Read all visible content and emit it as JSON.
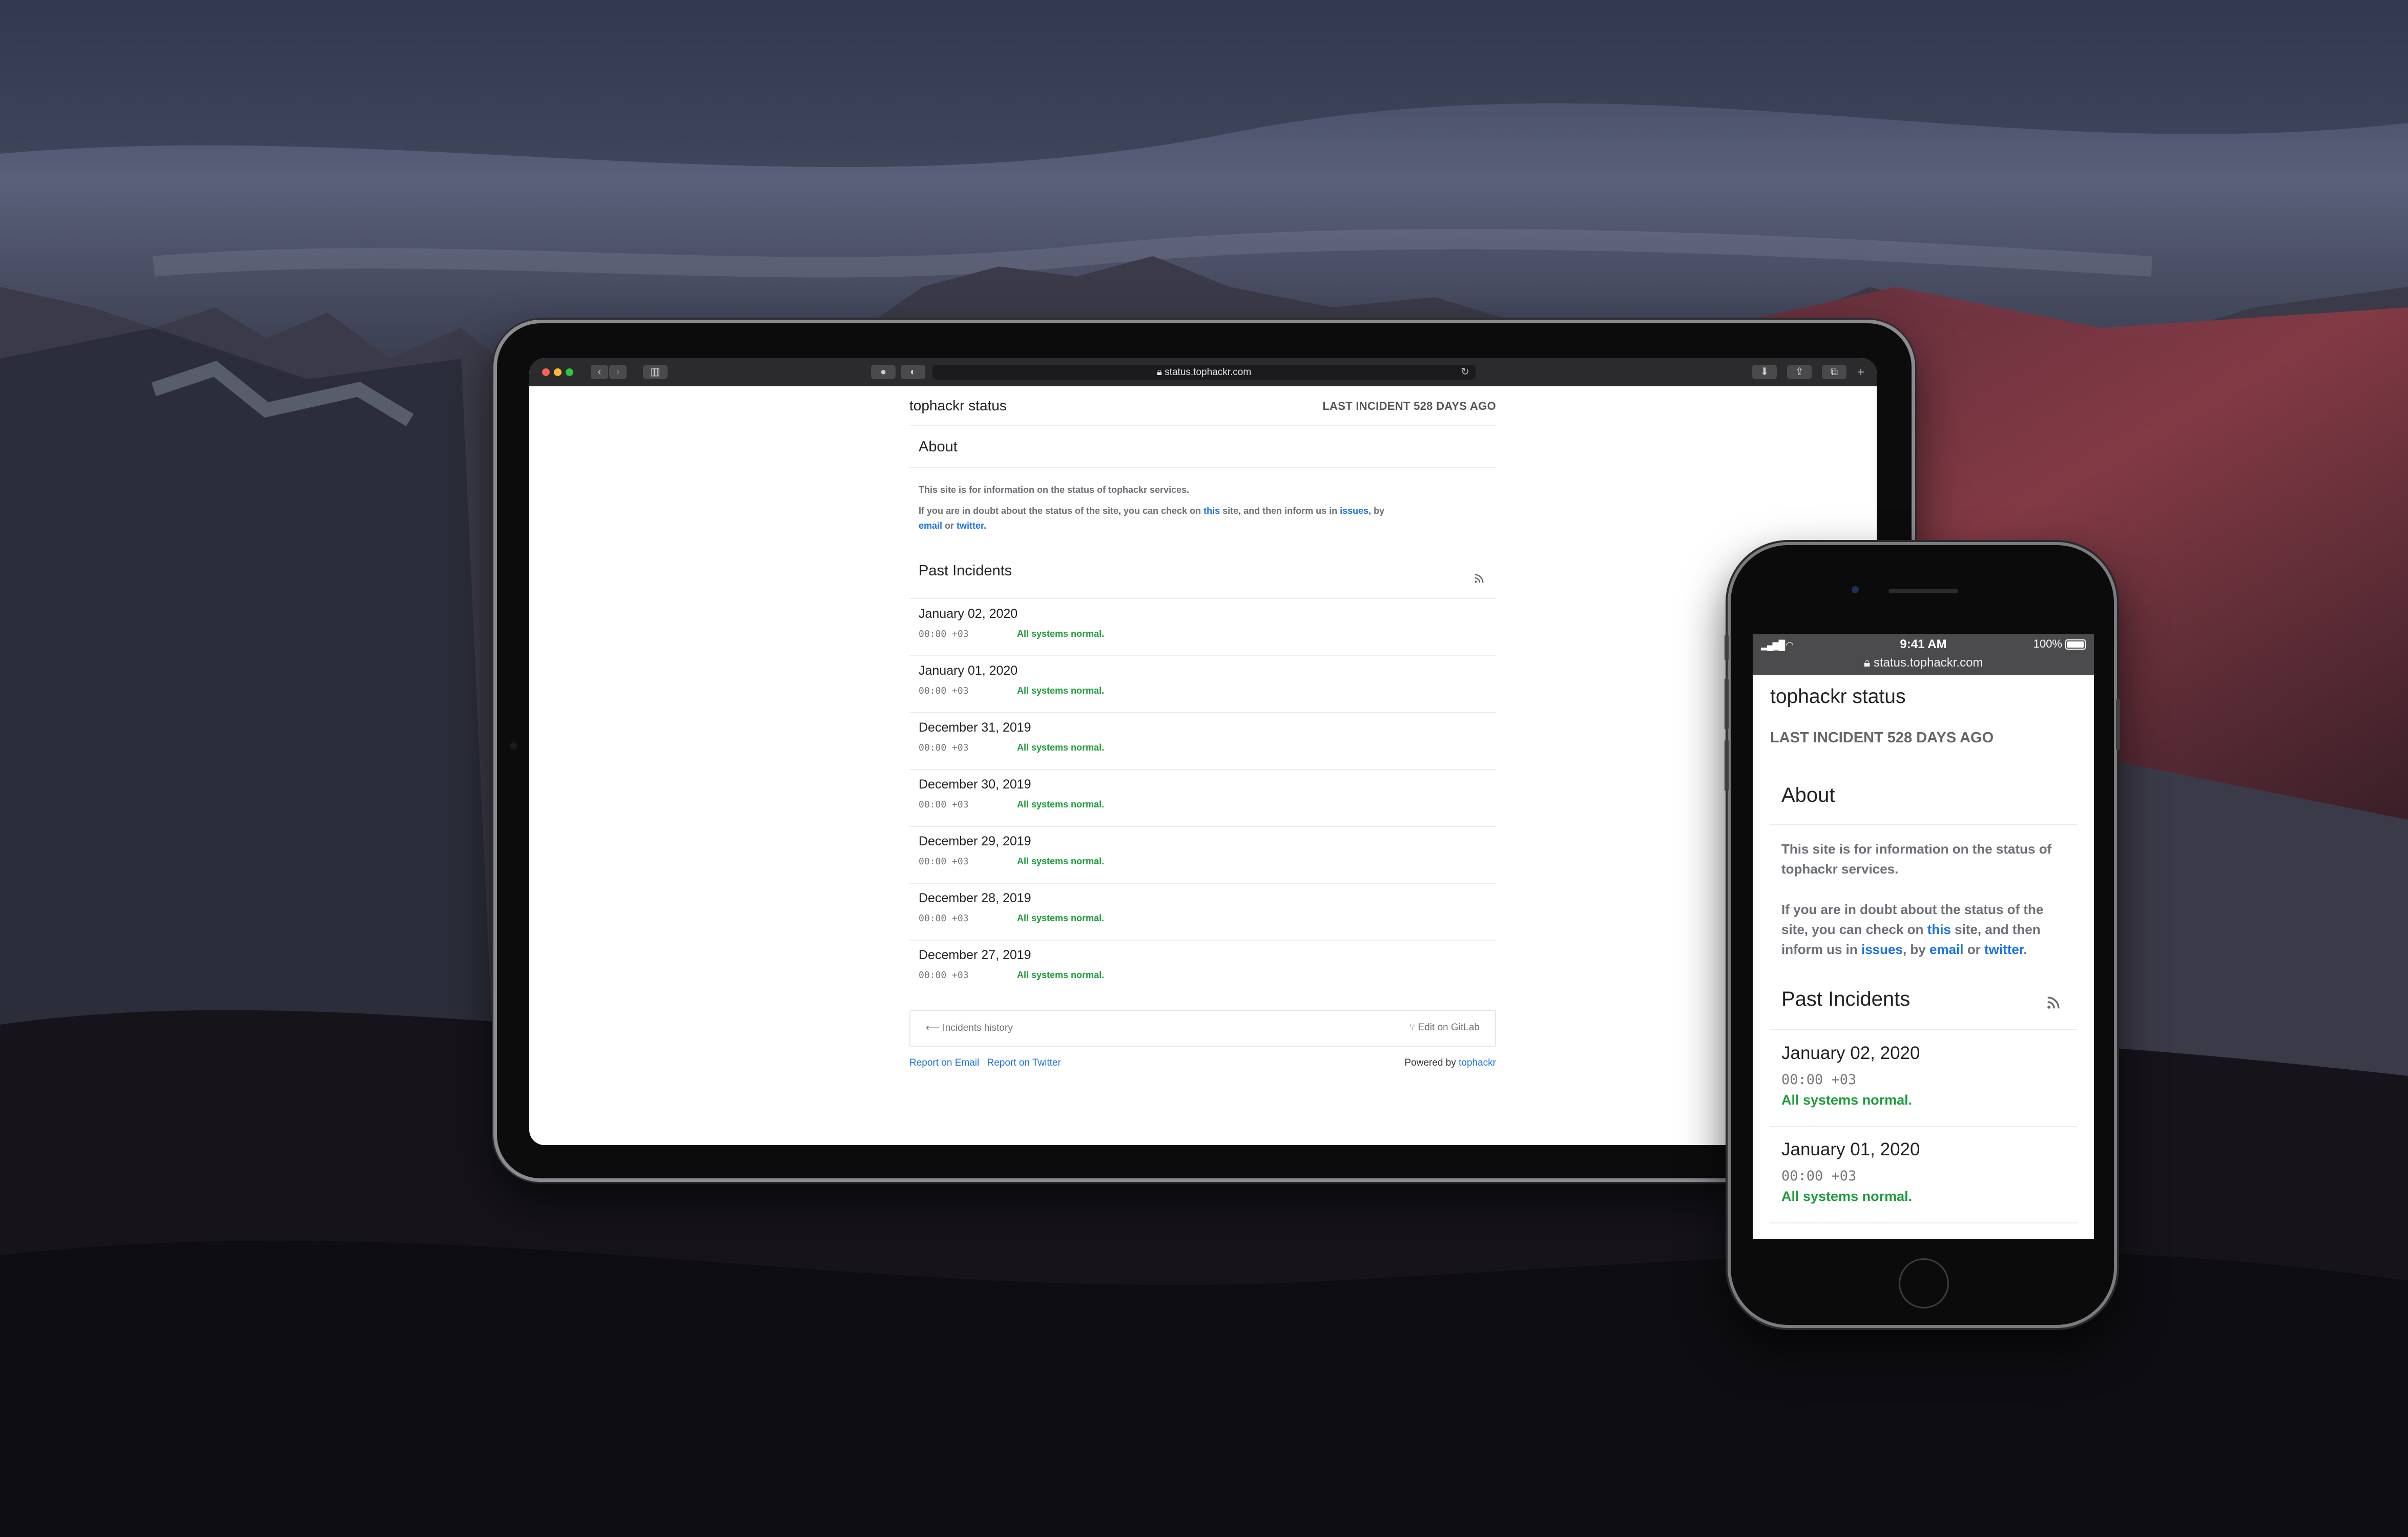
{
  "browser": {
    "url": "status.tophackr.com"
  },
  "site": {
    "title": "tophackr status",
    "last_incident": "LAST INCIDENT 528 DAYS AGO"
  },
  "about": {
    "heading": "About",
    "line1": "This site is for information on the status of tophackr services.",
    "line2_a": "If you are in doubt about the status of the site, you can check on ",
    "link_this": "this",
    "line2_b": " site, and then inform us in ",
    "link_issues": "issues",
    "line2_c": ", by",
    "link_email": "email",
    "line2_d": " or ",
    "link_twitter": "twitter",
    "line2_e": "."
  },
  "past_incidents": {
    "heading": "Past Incidents",
    "items": [
      {
        "date": "January 02, 2020",
        "time": "00:00 +03",
        "status": "All systems normal."
      },
      {
        "date": "January 01, 2020",
        "time": "00:00 +03",
        "status": "All systems normal."
      },
      {
        "date": "December 31, 2019",
        "time": "00:00 +03",
        "status": "All systems normal."
      },
      {
        "date": "December 30, 2019",
        "time": "00:00 +03",
        "status": "All systems normal."
      },
      {
        "date": "December 29, 2019",
        "time": "00:00 +03",
        "status": "All systems normal."
      },
      {
        "date": "December 28, 2019",
        "time": "00:00 +03",
        "status": "All systems normal."
      },
      {
        "date": "December 27, 2019",
        "time": "00:00 +03",
        "status": "All systems normal."
      }
    ]
  },
  "pager": {
    "history": "Incidents history",
    "edit": "Edit on GitLab"
  },
  "footer": {
    "report_email": "Report on Email",
    "report_twitter": "Report on Twitter",
    "powered_by": "Powered by ",
    "powered_link": "tophackr"
  },
  "phone": {
    "time": "9:41 AM",
    "battery": "100%"
  },
  "colors": {
    "link": "#1a73e8",
    "status_ok": "#1e9c3b"
  }
}
